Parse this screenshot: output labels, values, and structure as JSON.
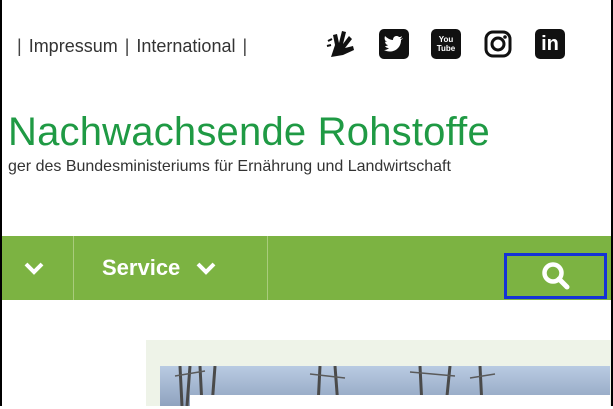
{
  "header": {
    "links": [
      "Impressum",
      "International"
    ],
    "social_icons": [
      "sign-language-icon",
      "twitter-icon",
      "youtube-icon",
      "instagram-icon",
      "linkedin-icon"
    ],
    "youtube_label": "You Tube"
  },
  "site": {
    "title": "Nachwachsende Rohstoffe",
    "subtitle": "ger des Bundesministeriums für Ernährung und Landwirtschaft"
  },
  "nav": {
    "service_label": "Service",
    "accent_color": "#7cb342"
  },
  "colors": {
    "title_green": "#1f9a44",
    "nav_green": "#7cb342",
    "focus_blue": "#1432d6"
  }
}
